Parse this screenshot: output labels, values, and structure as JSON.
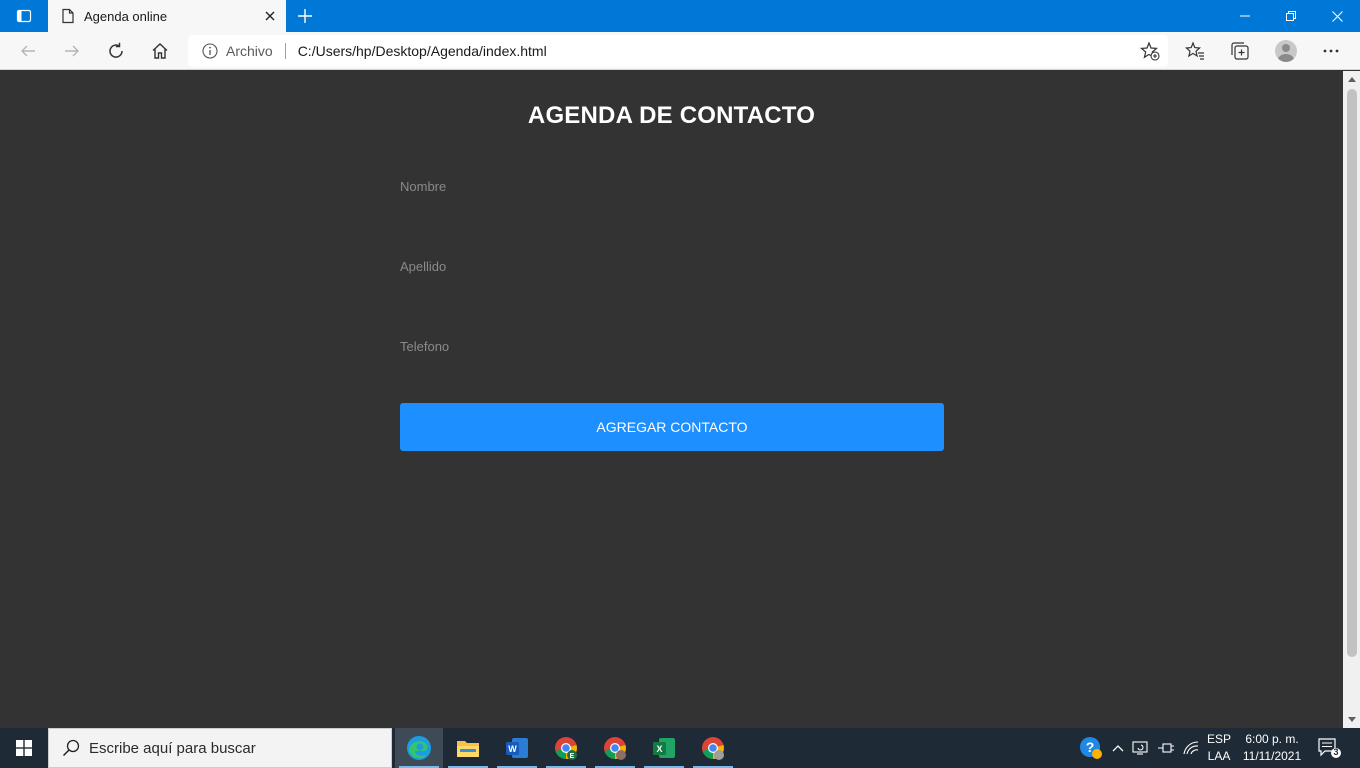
{
  "browser": {
    "tab_title": "Agenda online",
    "address_origin": "Archivo",
    "address_url": "C:/Users/hp/Desktop/Agenda/index.html"
  },
  "page": {
    "title": "AGENDA DE CONTACTO",
    "fields": {
      "nombre_placeholder": "Nombre",
      "apellido_placeholder": "Apellido",
      "telefono_placeholder": "Telefono"
    },
    "submit_label": "AGREGAR CONTACTO"
  },
  "taskbar": {
    "search_placeholder": "Escribe aquí para buscar",
    "language_line1": "ESP",
    "language_line2": "LAA",
    "time": "6:00 p. m.",
    "date": "11/11/2021",
    "notification_count": "3",
    "apps": [
      "edge",
      "file-explorer",
      "word",
      "chrome-e",
      "chrome-profile",
      "excel",
      "chrome-profile-2"
    ]
  },
  "colors": {
    "titlebar": "#0078d7",
    "page_background": "#333333",
    "button": "#1e8fff",
    "taskbar": "#1e2a36"
  }
}
